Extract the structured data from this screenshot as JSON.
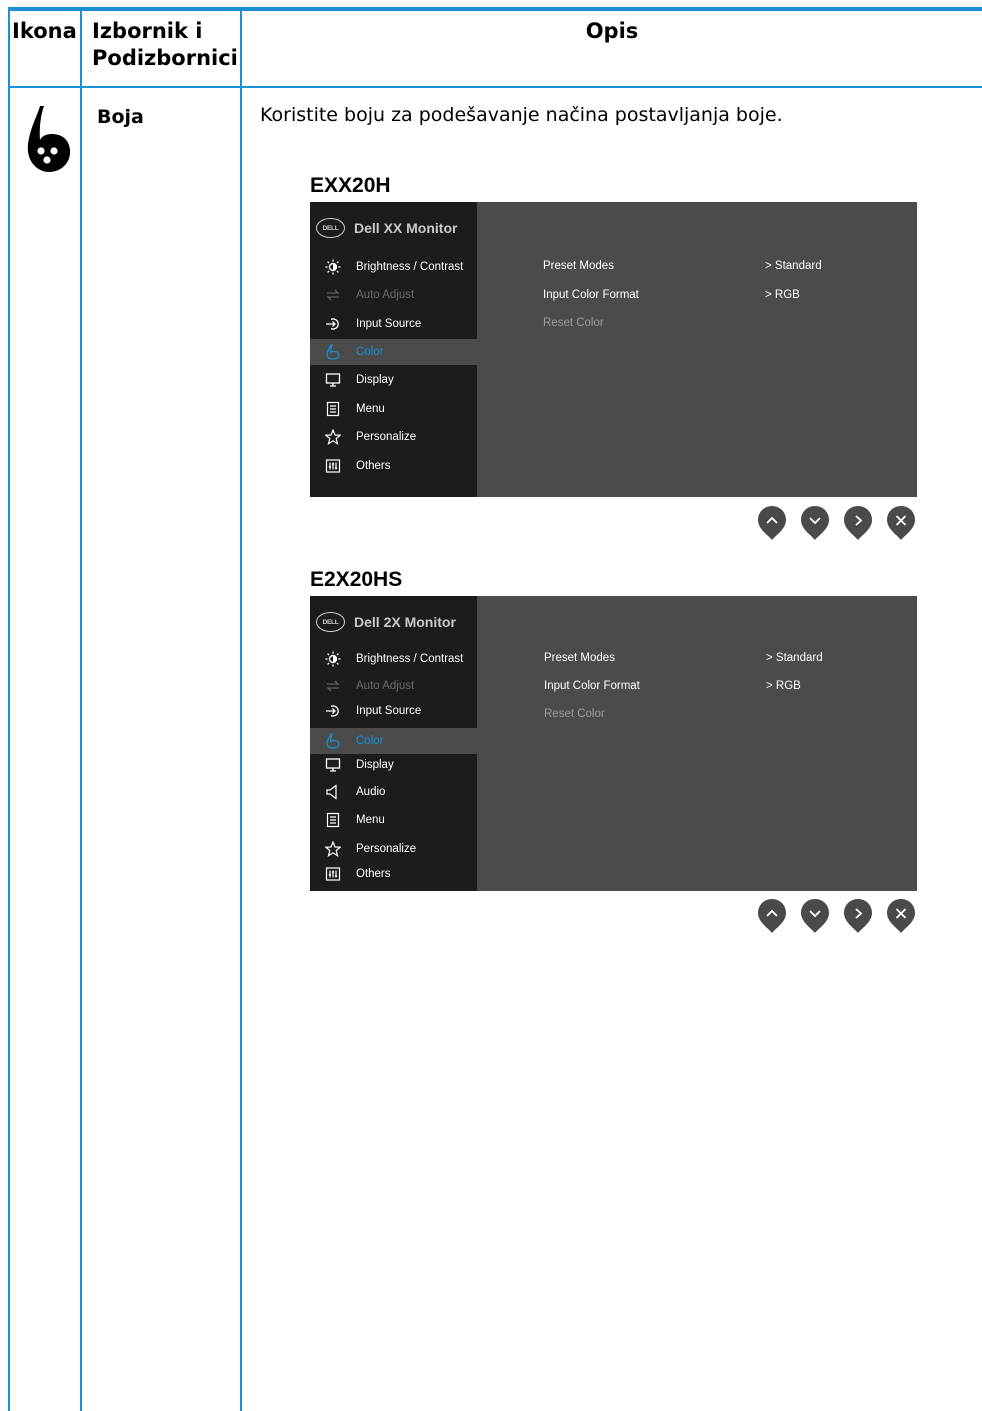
{
  "table": {
    "header": {
      "icon_col": "Ikona",
      "menu_col_line1": "Izbornik i",
      "menu_col_line2": "Podizbornici",
      "desc_col": "Opis"
    },
    "row": {
      "icon": "color-drop-icon",
      "menu": "Boja",
      "description": "Koristite boju za podešavanje načina postavljanja boje."
    }
  },
  "colors": {
    "rule": "#1a8fd6",
    "osd_bg": "#4b4b4b",
    "osd_sidebar": "#1c1c1c",
    "selected": "#1a8fd6",
    "button": "#4a4a4a"
  },
  "osd1": {
    "model": "EXX20H",
    "monitor_name": "Dell XX Monitor",
    "logo": "DELL",
    "menu": [
      {
        "label": "Brightness / Contrast",
        "icon": "brightness-icon",
        "state": "normal"
      },
      {
        "label": "Auto Adjust",
        "icon": "auto-adjust-icon",
        "state": "disabled"
      },
      {
        "label": "Input Source",
        "icon": "input-source-icon",
        "state": "normal"
      },
      {
        "label": "Color",
        "icon": "color-icon",
        "state": "selected"
      },
      {
        "label": "Display",
        "icon": "display-icon",
        "state": "normal"
      },
      {
        "label": "Menu",
        "icon": "menu-icon",
        "state": "normal"
      },
      {
        "label": "Personalize",
        "icon": "star-icon",
        "state": "normal"
      },
      {
        "label": "Others",
        "icon": "others-icon",
        "state": "normal"
      }
    ],
    "submenu": [
      {
        "label": "Preset Modes",
        "value": ">  Standard"
      },
      {
        "label": "Input Color Format",
        "value": ">  RGB"
      },
      {
        "label": "Reset Color",
        "value": ""
      }
    ]
  },
  "osd2": {
    "model": "E2X20HS",
    "monitor_name": "Dell 2X Monitor",
    "logo": "DELL",
    "menu": [
      {
        "label": "Brightness / Contrast",
        "icon": "brightness-icon",
        "state": "normal"
      },
      {
        "label": "Auto Adjust",
        "icon": "auto-adjust-icon",
        "state": "disabled"
      },
      {
        "label": "Input Source",
        "icon": "input-source-icon",
        "state": "normal"
      },
      {
        "label": "Color",
        "icon": "color-icon",
        "state": "selected"
      },
      {
        "label": "Display",
        "icon": "display-icon",
        "state": "normal"
      },
      {
        "label": "Audio",
        "icon": "speaker-icon",
        "state": "normal"
      },
      {
        "label": "Menu",
        "icon": "menu-icon",
        "state": "normal"
      },
      {
        "label": "Personalize",
        "icon": "star-icon",
        "state": "normal"
      },
      {
        "label": "Others",
        "icon": "others-icon",
        "state": "normal"
      }
    ],
    "submenu": [
      {
        "label": "Preset Modes",
        "value": ">  Standard"
      },
      {
        "label": "Input Color Format",
        "value": ">  RGB"
      },
      {
        "label": "Reset Color",
        "value": ""
      }
    ]
  },
  "buttons": [
    {
      "name": "up-button",
      "icon": "chevron-up-icon"
    },
    {
      "name": "down-button",
      "icon": "chevron-down-icon"
    },
    {
      "name": "right-button",
      "icon": "chevron-right-icon"
    },
    {
      "name": "close-button",
      "icon": "close-icon"
    }
  ]
}
